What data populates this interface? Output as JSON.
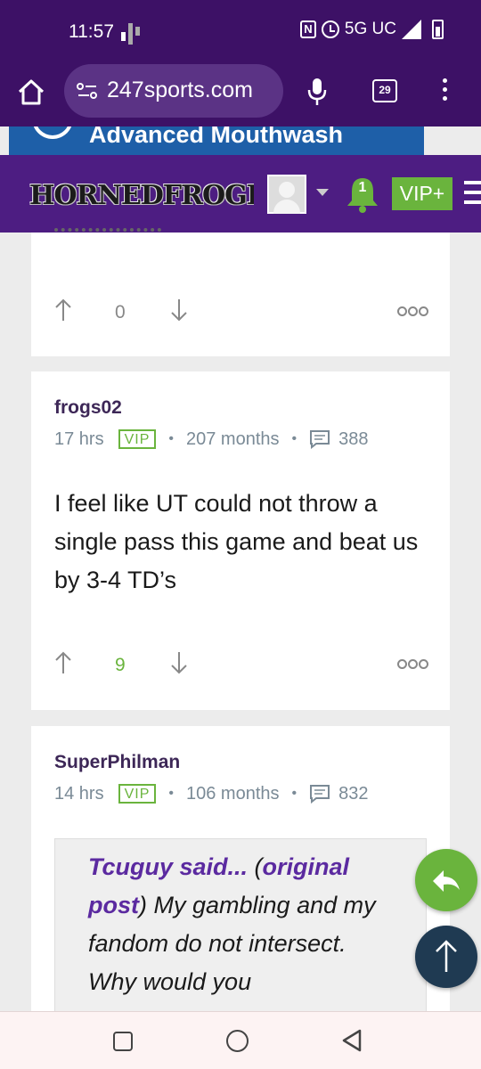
{
  "status_bar": {
    "time": "11:57",
    "network": "5G UC",
    "nfc_icon": "nfc-icon",
    "alarm_icon": "alarm-icon"
  },
  "browser": {
    "url": "247sports.com",
    "tab_count": "29"
  },
  "ad": {
    "text": "Advanced Mouthwash"
  },
  "site_header": {
    "logo_text": "HORNEDFROGBLITZ",
    "notification_count": "1",
    "vip_label": "VIP+"
  },
  "posts": [
    {
      "vote_count": "0"
    },
    {
      "author": "frogs02",
      "time": "17 hrs",
      "vip_badge": "VIP",
      "tenure": "207 months",
      "post_count": "388",
      "body": "I feel like UT could not throw a single pass this game and beat us by 3-4 TD’s",
      "vote_count": "9"
    },
    {
      "author": "SuperPhilman",
      "time": "14 hrs",
      "vip_badge": "VIP",
      "tenure": "106 months",
      "post_count": "832",
      "quote": {
        "said": "Tcuguy said...",
        "open_paren": " (",
        "link": "original post",
        "close_paren": ")",
        "text": " My gambling and my fandom do not intersect. Why would you"
      }
    }
  ],
  "colors": {
    "brand_purple": "#3d1166",
    "header_purple": "#4d1d82",
    "accent_green": "#6ab43d",
    "scroll_top_navy": "#1f3a52"
  }
}
